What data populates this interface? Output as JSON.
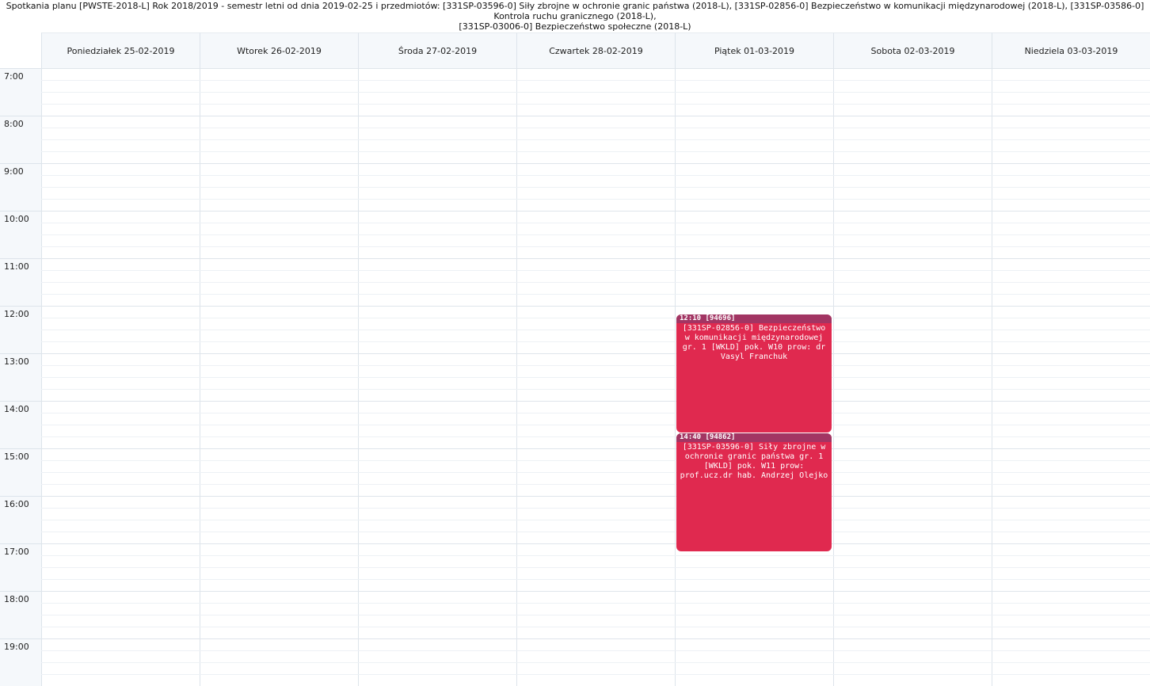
{
  "header": {
    "line1": "Spotkania planu [PWSTE-2018-L] Rok 2018/2019 - semestr letni od dnia 2019-02-25 i przedmiotów: [331SP-03596-0] Siły zbrojne w ochronie granic państwa (2018-L), [331SP-02856-0] Bezpieczeństwo w komunikacji międzynarodowej (2018-L), [331SP-03586-0] Kontrola ruchu granicznego (2018-L),",
    "line2": "[331SP-03006-0] Bezpieczeństwo społeczne (2018-L)"
  },
  "days": [
    {
      "label": "Poniedziałek 25-02-2019"
    },
    {
      "label": "Wtorek 26-02-2019"
    },
    {
      "label": "Środa 27-02-2019"
    },
    {
      "label": "Czwartek 28-02-2019"
    },
    {
      "label": "Piątek 01-03-2019"
    },
    {
      "label": "Sobota 02-03-2019"
    },
    {
      "label": "Niedziela 03-03-2019"
    }
  ],
  "hours": [
    "7:00",
    "8:00",
    "9:00",
    "10:00",
    "11:00",
    "12:00",
    "13:00",
    "14:00",
    "15:00",
    "16:00",
    "17:00",
    "18:00",
    "19:00"
  ],
  "events": [
    {
      "day": 4,
      "start": "12:10",
      "end": "14:40",
      "head": "12:10 [94696]",
      "body": "[331SP-02856-0] Bezpieczeństwo w komunikacji międzynarodowej gr. 1 [WKLD] pok. W10 prow: dr Vasyl Franchuk"
    },
    {
      "day": 4,
      "start": "14:40",
      "end": "17:10",
      "head": "14:40 [94862]",
      "body": "[331SP-03596-0] Siły zbrojne w ochronie granic państwa gr. 1 [WKLD] pok. W11 prow: prof.ucz.dr hab. Andrzej Olejko"
    }
  ],
  "colors": {
    "event_bg": "#e0294f",
    "event_head": "#a23563",
    "header_bg": "#f5f8fb"
  }
}
